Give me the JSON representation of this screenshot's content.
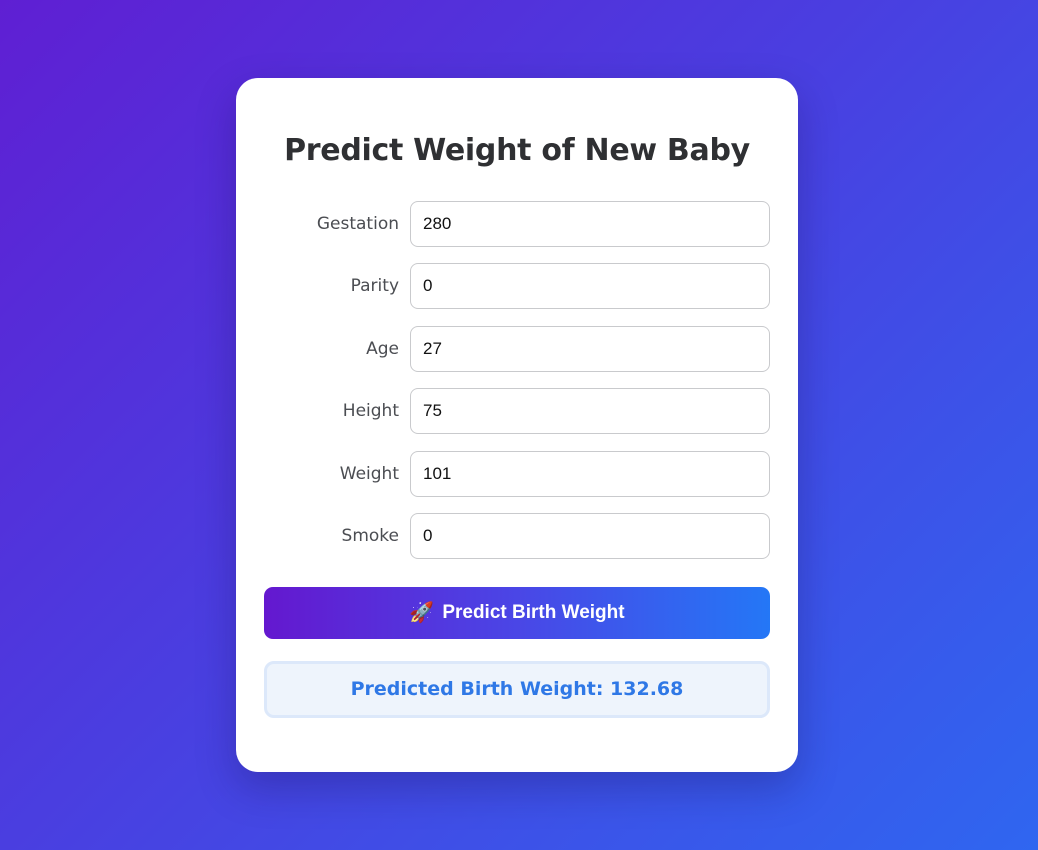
{
  "page": {
    "title": "Predict Weight of New Baby"
  },
  "form": {
    "fields": [
      {
        "label": "Gestation",
        "value": "280"
      },
      {
        "label": "Parity",
        "value": "0"
      },
      {
        "label": "Age",
        "value": "27"
      },
      {
        "label": "Height",
        "value": "75"
      },
      {
        "label": "Weight",
        "value": "101"
      },
      {
        "label": "Smoke",
        "value": "0"
      }
    ],
    "submit": {
      "icon": "rocket-icon",
      "icon_glyph": "🚀",
      "label": "Predict Birth Weight"
    }
  },
  "result": {
    "text": "Predicted Birth Weight: 132.68"
  },
  "colors": {
    "accent_start": "#6418cf",
    "accent_end": "#2477f6",
    "result_text": "#2f78e6",
    "result_bg": "#eef4fc"
  }
}
